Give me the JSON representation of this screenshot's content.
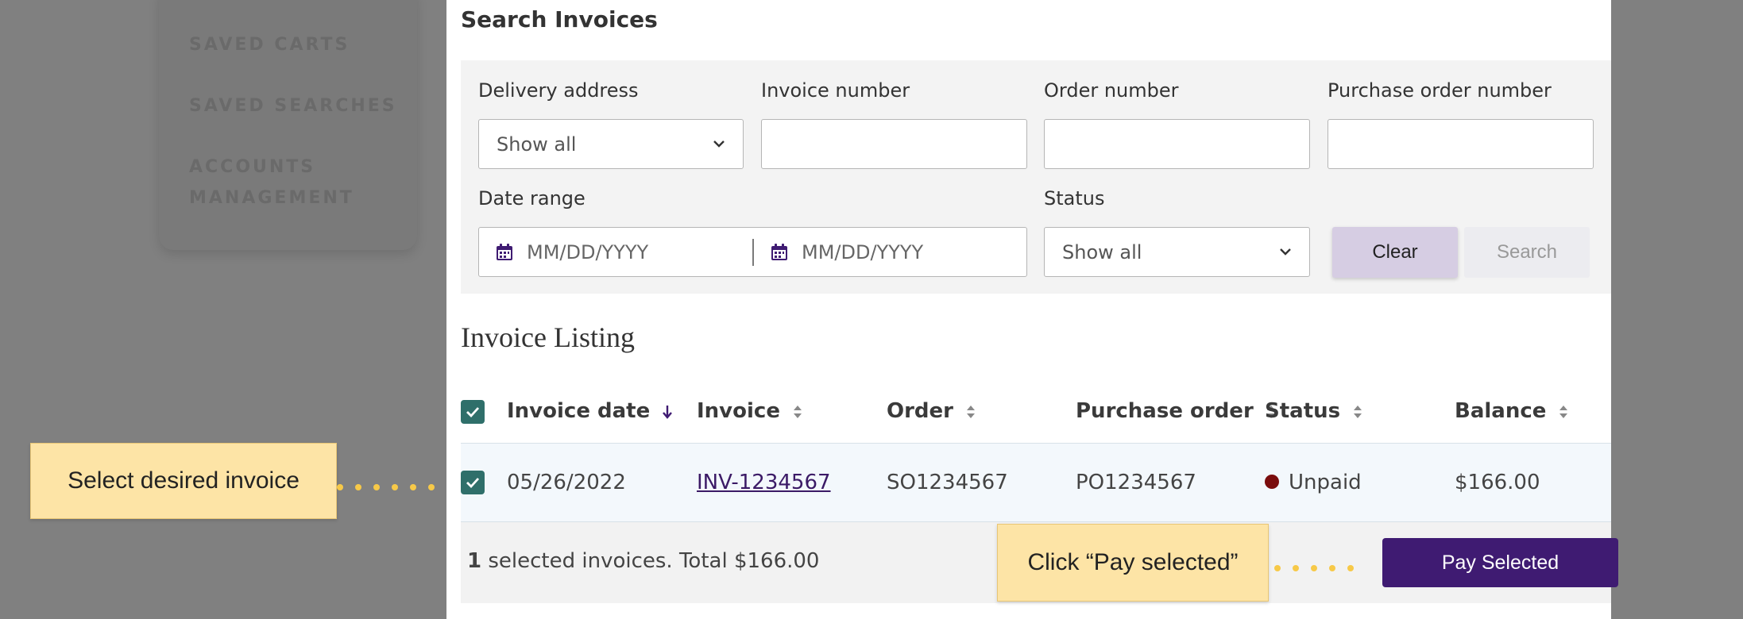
{
  "background_nav": {
    "items": [
      "SAVED CARTS",
      "SAVED SEARCHES",
      "ACCOUNTS",
      "MANAGEMENT"
    ]
  },
  "search": {
    "title": "Search Invoices",
    "delivery_address": {
      "label": "Delivery address",
      "value": "Show all"
    },
    "invoice_number": {
      "label": "Invoice number",
      "value": ""
    },
    "order_number": {
      "label": "Order number",
      "value": ""
    },
    "po_number": {
      "label": "Purchase order number",
      "value": ""
    },
    "date_range": {
      "label": "Date range",
      "start_placeholder": "MM/DD/YYYY",
      "end_placeholder": "MM/DD/YYYY"
    },
    "status": {
      "label": "Status",
      "value": "Show all"
    },
    "clear_label": "Clear",
    "search_label": "Search"
  },
  "listing": {
    "title": "Invoice Listing",
    "columns": [
      "Invoice date",
      "Invoice",
      "Order",
      "Purchase order",
      "Status",
      "Balance"
    ],
    "rows": [
      {
        "selected": true,
        "date": "05/26/2022",
        "invoice": "INV-1234567",
        "order": "SO1234567",
        "po": "PO1234567",
        "status": "Unpaid",
        "balance": "$166.00"
      }
    ]
  },
  "footer": {
    "selected_count": "1",
    "selected_text": " selected invoices. Total $166.00",
    "pay_label": "Pay Selected"
  },
  "callouts": {
    "select_invoice": "Select desired invoice",
    "pay_selected": "Click “Pay selected”"
  },
  "colors": {
    "accent": "#3f1b72",
    "checkbox": "#2f6f6a",
    "unpaid_dot": "#7a0d0d",
    "callout": "#fde4a6"
  }
}
